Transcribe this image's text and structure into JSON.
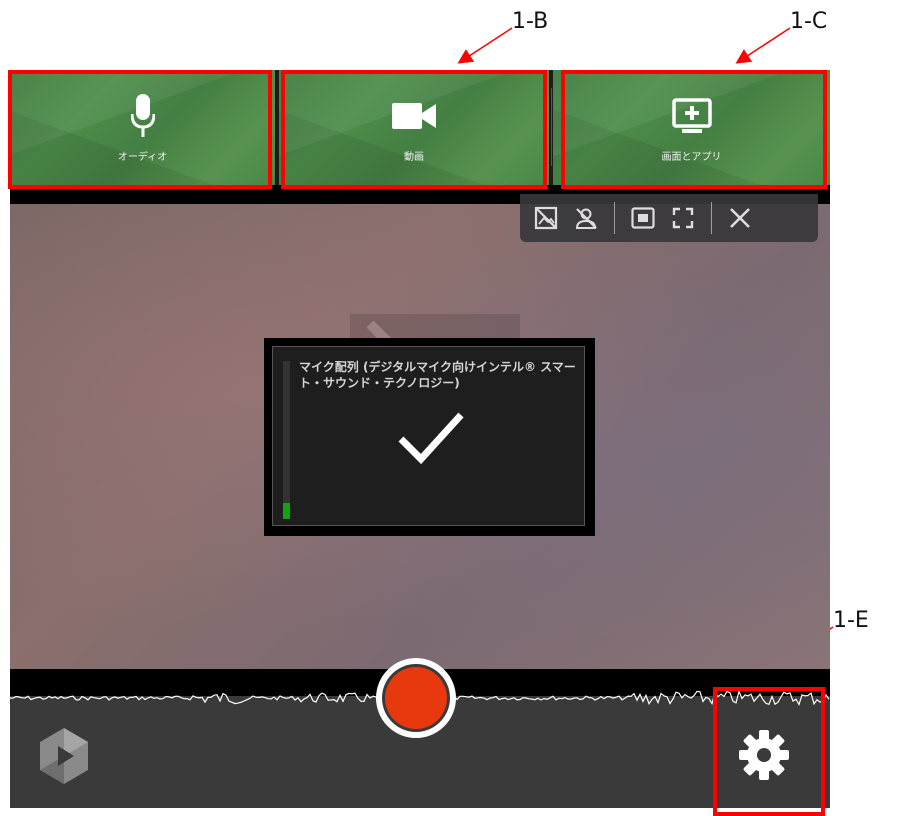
{
  "callouts": {
    "b": "1-B",
    "c": "1-C",
    "e": "1-E"
  },
  "modes": [
    {
      "label": "オーディオ",
      "icon": "microphone-icon"
    },
    {
      "label": "動画",
      "icon": "video-camera-icon"
    },
    {
      "label": "画面とアプリ",
      "icon": "screen-share-icon"
    }
  ],
  "video_toolbar": [
    "camera-off-icon",
    "person-off-icon",
    "picture-in-picture-icon",
    "fullscreen-icon",
    "close-icon"
  ],
  "mic_panel": {
    "device_name": "マイク配列 (デジタルマイク向けインテル® スマート・サウンド・テクノロジー)",
    "level": 0.1,
    "status_icon": "checkmark-icon"
  },
  "colors": {
    "mode_green": "#4a8747",
    "record_red": "#e8380d",
    "annotation_red": "#ff0000",
    "level_green": "#12a312"
  }
}
